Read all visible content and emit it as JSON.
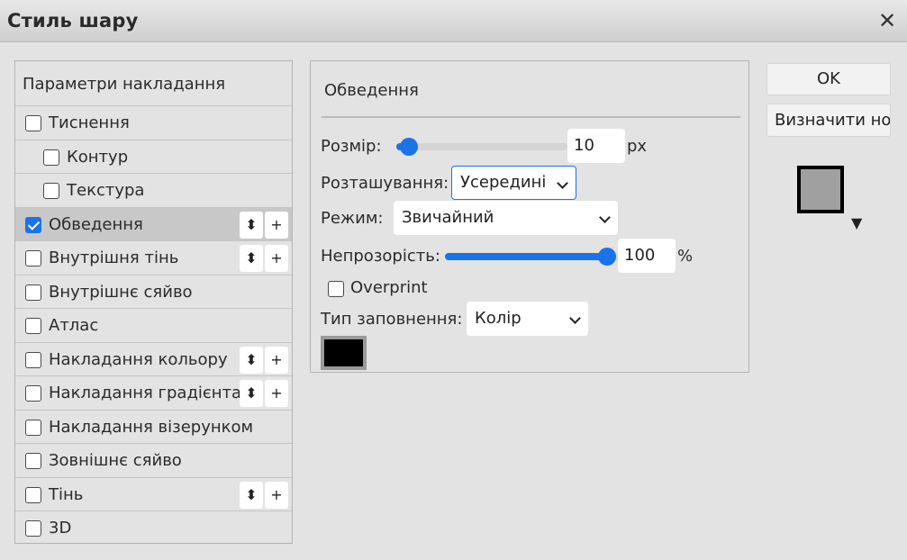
{
  "dialog": {
    "title": "Стиль шару",
    "close_label": "✕"
  },
  "layers_panel": {
    "header": "Параметри накладання",
    "items": [
      {
        "label": "Тиснення",
        "checked": false,
        "indent": false,
        "controls": false
      },
      {
        "label": "Контур",
        "checked": false,
        "indent": true,
        "controls": false
      },
      {
        "label": "Текстура",
        "checked": false,
        "indent": true,
        "controls": false
      },
      {
        "label": "Обведення",
        "checked": true,
        "indent": false,
        "controls": true,
        "selected": true
      },
      {
        "label": "Внутрішня тінь",
        "checked": false,
        "indent": false,
        "controls": true
      },
      {
        "label": "Внутрішнє сяйво",
        "checked": false,
        "indent": false,
        "controls": false
      },
      {
        "label": "Атлас",
        "checked": false,
        "indent": false,
        "controls": false
      },
      {
        "label": "Накладання кольору",
        "checked": false,
        "indent": false,
        "controls": true
      },
      {
        "label": "Накладання градієнта",
        "checked": false,
        "indent": false,
        "controls": true
      },
      {
        "label": "Накладання візерунком",
        "checked": false,
        "indent": false,
        "controls": false
      },
      {
        "label": "Зовнішнє сяйво",
        "checked": false,
        "indent": false,
        "controls": false
      },
      {
        "label": "Тінь",
        "checked": false,
        "indent": false,
        "controls": true
      },
      {
        "label": "3D",
        "checked": false,
        "indent": false,
        "controls": false
      }
    ],
    "reorder_icon": "⬍",
    "add_icon": "+"
  },
  "stroke": {
    "title": "Обведення",
    "size_label": "Розмір:",
    "size_value": "10",
    "size_unit": "px",
    "size_fraction": 0.05,
    "position_label": "Розташування:",
    "position_value": "Усередині",
    "mode_label": "Режим:",
    "mode_value": "Звичайний",
    "opacity_label": "Непрозорість:",
    "opacity_value": "100",
    "opacity_unit": "%",
    "opacity_fraction": 1.0,
    "overprint_label": "Overprint",
    "overprint_checked": false,
    "fill_type_label": "Тип заповнення:",
    "fill_type_value": "Колір",
    "fill_color": "#000000"
  },
  "actions": {
    "ok_label": "OK",
    "default_label": "Визначити но"
  },
  "preview": {
    "arrow": "▼",
    "fill_color": "#a0a0a0"
  },
  "colors": {
    "accent": "#1a73e8",
    "background": "#e3e3e3",
    "selected_row": "#c8c8c8"
  }
}
